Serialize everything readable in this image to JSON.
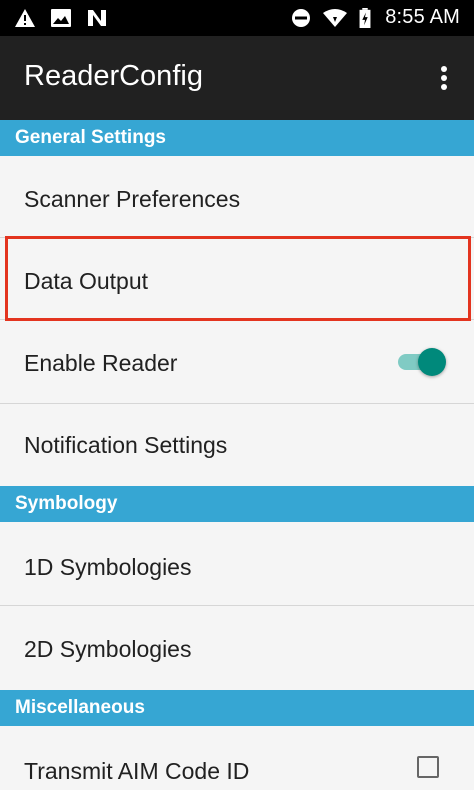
{
  "status_bar": {
    "time": "8:55 AM",
    "left_icons": [
      "warning-icon",
      "image-icon",
      "n-icon"
    ],
    "right_icons": [
      "do-not-disturb-icon",
      "wifi-icon",
      "battery-charging-icon"
    ]
  },
  "app_bar": {
    "title": "ReaderConfig",
    "menu_icon": "overflow-menu-icon"
  },
  "sections": [
    {
      "header": "General Settings",
      "items": [
        {
          "label": "Scanner Preferences"
        },
        {
          "label": "Data Output",
          "highlighted": true
        },
        {
          "label": "Enable Reader",
          "control": "toggle",
          "state": "on"
        },
        {
          "label": "Notification Settings"
        }
      ]
    },
    {
      "header": "Symbology",
      "items": [
        {
          "label": "1D Symbologies"
        },
        {
          "label": "2D Symbologies"
        }
      ]
    },
    {
      "header": "Miscellaneous",
      "items": [
        {
          "label": "Transmit AIM Code ID",
          "control": "checkbox",
          "state": "unchecked"
        }
      ]
    }
  ],
  "colors": {
    "status_bar": "#000000",
    "app_bar": "#212121",
    "section_header": "#36a6d3",
    "background": "#f5f5f5",
    "highlight": "#e3341f",
    "toggle_thumb": "#00897b",
    "toggle_track": "#80cbc4"
  }
}
